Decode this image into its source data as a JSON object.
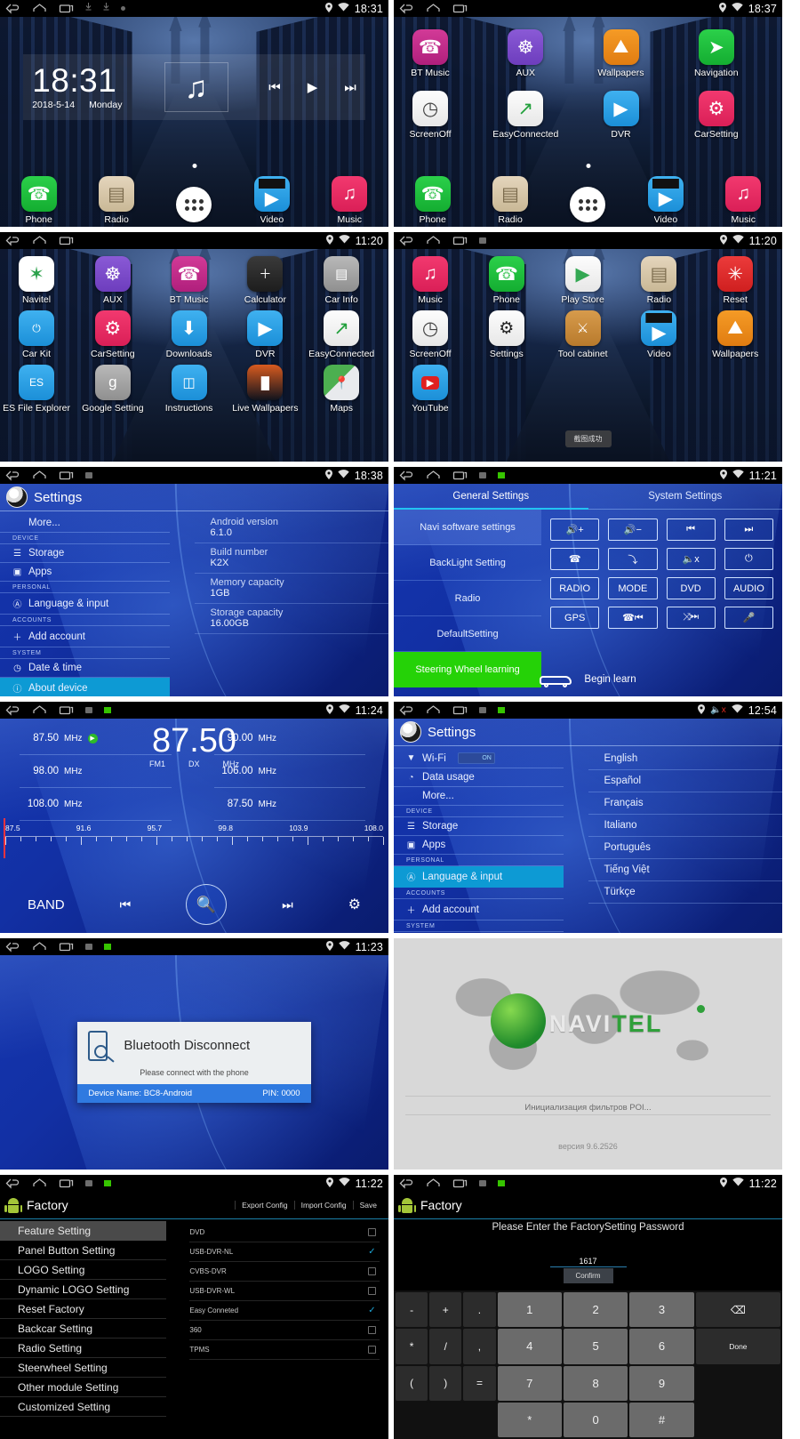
{
  "panels": [
    {
      "id": "home-clock",
      "statusbar": {
        "time": "18:31",
        "icons": [
          "back-icon",
          "home-icon",
          "recents-icon",
          "download-icon",
          "download-icon",
          "dot-icon",
          "location-icon",
          "wifi-icon"
        ]
      },
      "widget": {
        "time": "18:31",
        "date": "2018-5-14",
        "weekday": "Monday",
        "music_icon": "music-note-icon",
        "controls": [
          "prev-track-icon",
          "play-icon",
          "next-track-icon"
        ]
      },
      "dock": [
        {
          "label": "Phone",
          "icon": "phone-icon",
          "color": "green"
        },
        {
          "label": "Radio",
          "icon": "radio-icon",
          "color": "tan"
        },
        {
          "label": "",
          "icon": "app-drawer-icon",
          "color": "appdraw"
        },
        {
          "label": "Video",
          "icon": "video-icon",
          "color": "videoic"
        },
        {
          "label": "Music",
          "icon": "music-icon",
          "color": "pink"
        }
      ]
    },
    {
      "id": "home-apps-page2",
      "statusbar": {
        "time": "18:37"
      },
      "apps": [
        {
          "label": "BT Music",
          "icon": "bt-music-icon",
          "color": "magenta",
          "glyph": "☎"
        },
        {
          "label": "AUX",
          "icon": "aux-icon",
          "color": "purple",
          "glyph": "⚇"
        },
        {
          "label": "Wallpapers",
          "icon": "wallpapers-icon",
          "color": "orange",
          "glyph": "⛰"
        },
        {
          "label": "Navigation",
          "icon": "navigation-icon",
          "color": "green",
          "glyph": "➤"
        },
        {
          "label": "ScreenOff",
          "icon": "screen-off-icon",
          "color": "white",
          "glyph": "◴"
        },
        {
          "label": "EasyConnected",
          "icon": "easy-connected-icon",
          "color": "white",
          "glyph": "↗"
        },
        {
          "label": "DVR",
          "icon": "dvr-icon",
          "color": "blue",
          "glyph": "▶"
        },
        {
          "label": "CarSetting",
          "icon": "car-setting-icon",
          "color": "pink",
          "glyph": "⚙"
        }
      ],
      "dock": [
        {
          "label": "Phone",
          "icon": "phone-icon",
          "color": "green"
        },
        {
          "label": "Radio",
          "icon": "radio-icon",
          "color": "tan"
        },
        {
          "label": "",
          "icon": "app-drawer-icon",
          "color": "appdraw"
        },
        {
          "label": "Video",
          "icon": "video-icon",
          "color": "videoic"
        },
        {
          "label": "Music",
          "icon": "music-icon",
          "color": "pink"
        }
      ]
    },
    {
      "id": "app-drawer-page1",
      "statusbar": {
        "time": "11:20"
      },
      "apps": [
        {
          "label": "Navitel",
          "icon": "navitel-icon",
          "color": "navwhite",
          "glyph": "✶"
        },
        {
          "label": "AUX",
          "icon": "aux-icon",
          "color": "purple",
          "glyph": "⚇"
        },
        {
          "label": "BT Music",
          "icon": "bt-music-icon",
          "color": "magenta",
          "glyph": "☎"
        },
        {
          "label": "Calculator",
          "icon": "calculator-icon",
          "color": "dark",
          "glyph": "＋"
        },
        {
          "label": "Car Info",
          "icon": "car-info-icon",
          "color": "blue",
          "glyph": "▤"
        },
        {
          "label": "Car Kit",
          "icon": "car-kit-icon",
          "color": "blue",
          "glyph": "⏻"
        },
        {
          "label": "CarSetting",
          "icon": "car-setting-icon",
          "color": "pink",
          "glyph": "⚙"
        },
        {
          "label": "Downloads",
          "icon": "downloads-icon",
          "color": "blue",
          "glyph": "⬇"
        },
        {
          "label": "DVR",
          "icon": "dvr-icon",
          "color": "blue",
          "glyph": "▶"
        },
        {
          "label": "EasyConnected",
          "icon": "easy-connected-icon",
          "color": "white",
          "glyph": "↗"
        },
        {
          "label": "ES File Explorer",
          "icon": "es-file-explorer-icon",
          "color": "blue",
          "glyph": "ES"
        },
        {
          "label": "Google Setting",
          "icon": "google-setting-icon",
          "color": "grey",
          "glyph": "g"
        },
        {
          "label": "Instructions",
          "icon": "instructions-icon",
          "color": "blue",
          "glyph": "📖"
        },
        {
          "label": "Live Wallpapers",
          "icon": "live-wallpapers-icon",
          "color": "dark",
          "glyph": "▦"
        },
        {
          "label": "Maps",
          "icon": "maps-icon",
          "color": "white",
          "glyph": "📍"
        }
      ]
    },
    {
      "id": "app-drawer-page2",
      "statusbar": {
        "time": "11:20"
      },
      "toast": "截图成功",
      "apps": [
        {
          "label": "Music",
          "icon": "music-icon",
          "color": "pink",
          "glyph": "♫"
        },
        {
          "label": "Phone",
          "icon": "phone-icon",
          "color": "green",
          "glyph": "✆"
        },
        {
          "label": "Play Store",
          "icon": "play-store-icon",
          "color": "white",
          "glyph": "▶"
        },
        {
          "label": "Radio",
          "icon": "radio-icon",
          "color": "tan",
          "glyph": "▣"
        },
        {
          "label": "Reset",
          "icon": "reset-icon",
          "color": "red",
          "glyph": "✳"
        },
        {
          "label": "ScreenOff",
          "icon": "screen-off-icon",
          "color": "white",
          "glyph": "◴"
        },
        {
          "label": "Settings",
          "icon": "settings-icon",
          "color": "white",
          "glyph": "⚙"
        },
        {
          "label": "Tool cabinet",
          "icon": "tool-cabinet-icon",
          "color": "brown",
          "glyph": "⚒"
        },
        {
          "label": "Video",
          "icon": "video-icon",
          "color": "videoic",
          "glyph": "▶"
        },
        {
          "label": "Wallpapers",
          "icon": "wallpapers-icon",
          "color": "orange",
          "glyph": "⛰"
        },
        {
          "label": "YouTube",
          "icon": "youtube-icon",
          "color": "blue",
          "glyph": "▶"
        }
      ]
    },
    {
      "id": "settings-about",
      "statusbar": {
        "time": "18:38"
      },
      "title": "Settings",
      "menu": [
        {
          "label": "More...",
          "type": "item",
          "icon": ""
        },
        {
          "label": "DEVICE",
          "type": "head"
        },
        {
          "label": "Storage",
          "type": "item",
          "icon": "☰"
        },
        {
          "label": "Apps",
          "type": "item",
          "icon": "▣"
        },
        {
          "label": "PERSONAL",
          "type": "head"
        },
        {
          "label": "Language & input",
          "type": "item",
          "icon": "Ⓐ"
        },
        {
          "label": "ACCOUNTS",
          "type": "head"
        },
        {
          "label": "Add account",
          "type": "item",
          "icon": "＋"
        },
        {
          "label": "SYSTEM",
          "type": "head"
        },
        {
          "label": "Date & time",
          "type": "item",
          "icon": "◴"
        },
        {
          "label": "About device",
          "type": "item",
          "icon": "ⓘ",
          "selected": true
        }
      ],
      "details": [
        {
          "key": "Android version",
          "value": "6.1.0"
        },
        {
          "key": "Build number",
          "value": "K2X"
        },
        {
          "key": "Memory capacity",
          "value": "1GB"
        },
        {
          "key": "Storage capacity",
          "value": "16.00GB"
        }
      ]
    },
    {
      "id": "car-settings-steering",
      "statusbar": {
        "time": "11:21"
      },
      "tabs": [
        {
          "label": "General Settings",
          "active": true
        },
        {
          "label": "System Settings",
          "active": false
        }
      ],
      "list": [
        {
          "label": "Navi software settings",
          "state": "hi"
        },
        {
          "label": "BackLight Setting",
          "state": ""
        },
        {
          "label": "Radio",
          "state": ""
        },
        {
          "label": "DefaultSetting",
          "state": ""
        },
        {
          "label": "Steering Wheel learning",
          "state": "green"
        }
      ],
      "buttons": [
        {
          "label": "",
          "icon": "volume-up-icon",
          "glyph": "🔊+"
        },
        {
          "label": "",
          "icon": "volume-down-icon",
          "glyph": "🔊−"
        },
        {
          "label": "",
          "icon": "prev-track-icon",
          "glyph": "⏮"
        },
        {
          "label": "",
          "icon": "next-track-icon",
          "glyph": "⏭"
        },
        {
          "label": "",
          "icon": "call-answer-icon",
          "glyph": "✆"
        },
        {
          "label": "",
          "icon": "call-end-icon",
          "glyph": "⤵"
        },
        {
          "label": "",
          "icon": "mute-icon",
          "glyph": "🔈x"
        },
        {
          "label": "",
          "icon": "power-icon",
          "glyph": "⏻"
        },
        {
          "label": "RADIO",
          "icon": "radio-button",
          "glyph": ""
        },
        {
          "label": "MODE",
          "icon": "mode-button",
          "glyph": ""
        },
        {
          "label": "DVD",
          "icon": "dvd-button",
          "glyph": ""
        },
        {
          "label": "AUDIO",
          "icon": "audio-button",
          "glyph": ""
        },
        {
          "label": "GPS",
          "icon": "gps-button",
          "glyph": ""
        },
        {
          "label": "",
          "icon": "call-prev-icon",
          "glyph": "✆ ⏮"
        },
        {
          "label": "",
          "icon": "shuffle-next-icon",
          "glyph": "⤨ ⏭"
        },
        {
          "label": "",
          "icon": "mic-icon",
          "glyph": "🎤"
        }
      ],
      "begin_learn": "Begin learn",
      "car_icon": "car-icon"
    },
    {
      "id": "radio-fm",
      "statusbar": {
        "time": "11:24"
      },
      "presets_left": [
        {
          "freq": "87.50",
          "unit": "MHz",
          "playing": true
        },
        {
          "freq": "98.00",
          "unit": "MHz",
          "playing": false
        },
        {
          "freq": "108.00",
          "unit": "MHz",
          "playing": false
        }
      ],
      "presets_right": [
        {
          "freq": "90.00",
          "unit": "MHz",
          "playing": false
        },
        {
          "freq": "106.00",
          "unit": "MHz",
          "playing": false
        },
        {
          "freq": "87.50",
          "unit": "MHz",
          "playing": false
        }
      ],
      "current": {
        "frequency": "87.50",
        "band": "FM1",
        "mode": "DX",
        "unit": "MHz"
      },
      "scale_labels": [
        "87.5",
        "91.6",
        "95.7",
        "99.8",
        "103.9",
        "108.0"
      ],
      "controls": [
        {
          "label": "BAND",
          "icon": "band-button"
        },
        {
          "label": "",
          "icon": "prev-station-icon",
          "glyph": "⏮"
        },
        {
          "label": "",
          "icon": "search-icon",
          "glyph": "🔍"
        },
        {
          "label": "",
          "icon": "next-station-icon",
          "glyph": "⏭"
        },
        {
          "label": "",
          "icon": "gear-icon",
          "glyph": "⚙"
        }
      ]
    },
    {
      "id": "settings-language",
      "statusbar": {
        "time": "12:54",
        "mute": true
      },
      "title": "Settings",
      "menu": [
        {
          "label": "Wi-Fi",
          "type": "item",
          "icon": "▼",
          "toggle": "ON"
        },
        {
          "label": "Data usage",
          "type": "item",
          "icon": "◔"
        },
        {
          "label": "More...",
          "type": "item",
          "icon": ""
        },
        {
          "label": "DEVICE",
          "type": "head"
        },
        {
          "label": "Storage",
          "type": "item",
          "icon": "☰"
        },
        {
          "label": "Apps",
          "type": "item",
          "icon": "▣"
        },
        {
          "label": "PERSONAL",
          "type": "head"
        },
        {
          "label": "Language & input",
          "type": "item",
          "icon": "Ⓐ",
          "selected": true
        },
        {
          "label": "ACCOUNTS",
          "type": "head"
        },
        {
          "label": "Add account",
          "type": "item",
          "icon": "＋"
        },
        {
          "label": "SYSTEM",
          "type": "head"
        }
      ],
      "languages": [
        "English",
        "Español",
        "Français",
        "Italiano",
        "Português",
        "Tiếng Việt",
        "Türkçe"
      ]
    },
    {
      "id": "bluetooth-disconnect",
      "statusbar": {
        "time": "11:23"
      },
      "dialog": {
        "title": "Bluetooth Disconnect",
        "subtitle": "Please connect with the phone",
        "device_label": "Device Name: BC8-Android",
        "pin_label": "PIN:  0000",
        "icon": "phone-search-icon"
      }
    },
    {
      "id": "navitel-splash",
      "brand": "NAVI",
      "brand_accent": "TEL",
      "status": "Инициализация фильтров POI...",
      "version": "версия 9.6.2526"
    },
    {
      "id": "factory-feature",
      "statusbar": {
        "time": "11:22"
      },
      "title": "Factory",
      "actions": [
        "Export Config",
        "Import Config",
        "Save"
      ],
      "menu": [
        {
          "label": "Feature Setting",
          "selected": true
        },
        {
          "label": "Panel Button Setting"
        },
        {
          "label": "LOGO Setting"
        },
        {
          "label": "Dynamic LOGO Setting"
        },
        {
          "label": "Reset Factory"
        },
        {
          "label": "Backcar Setting"
        },
        {
          "label": "Radio Setting"
        },
        {
          "label": "Steerwheel Setting"
        },
        {
          "label": "Other module Setting"
        },
        {
          "label": "Customized Setting"
        }
      ],
      "features": [
        {
          "label": "DVD",
          "checked": false
        },
        {
          "label": "USB-DVR-NL",
          "checked": true
        },
        {
          "label": "CVBS-DVR",
          "checked": false
        },
        {
          "label": "USB-DVR-WL",
          "checked": false
        },
        {
          "label": "Easy Conneted",
          "checked": true
        },
        {
          "label": "360",
          "checked": false
        },
        {
          "label": "TPMS",
          "checked": false
        }
      ]
    },
    {
      "id": "factory-password",
      "statusbar": {
        "time": "11:22"
      },
      "title": "Factory",
      "prompt": "Please Enter the FactorySetting Password",
      "input_value": "1617",
      "confirm": "Confirm",
      "keys_sym": [
        "-",
        "+",
        ".",
        "*",
        "/",
        ",",
        "(",
        ")",
        "=",
        "",
        "",
        ""
      ],
      "keys_num": [
        "1",
        "2",
        "3",
        "4",
        "5",
        "6",
        "7",
        "8",
        "9",
        "*",
        "0",
        "#"
      ],
      "keys_side": [
        {
          "label": "⌫",
          "name": "backspace-key"
        },
        {
          "label": "Done",
          "name": "done-key"
        },
        {
          "label": "",
          "name": "blank-key"
        },
        {
          "label": "",
          "name": "blank-key"
        }
      ]
    }
  ]
}
